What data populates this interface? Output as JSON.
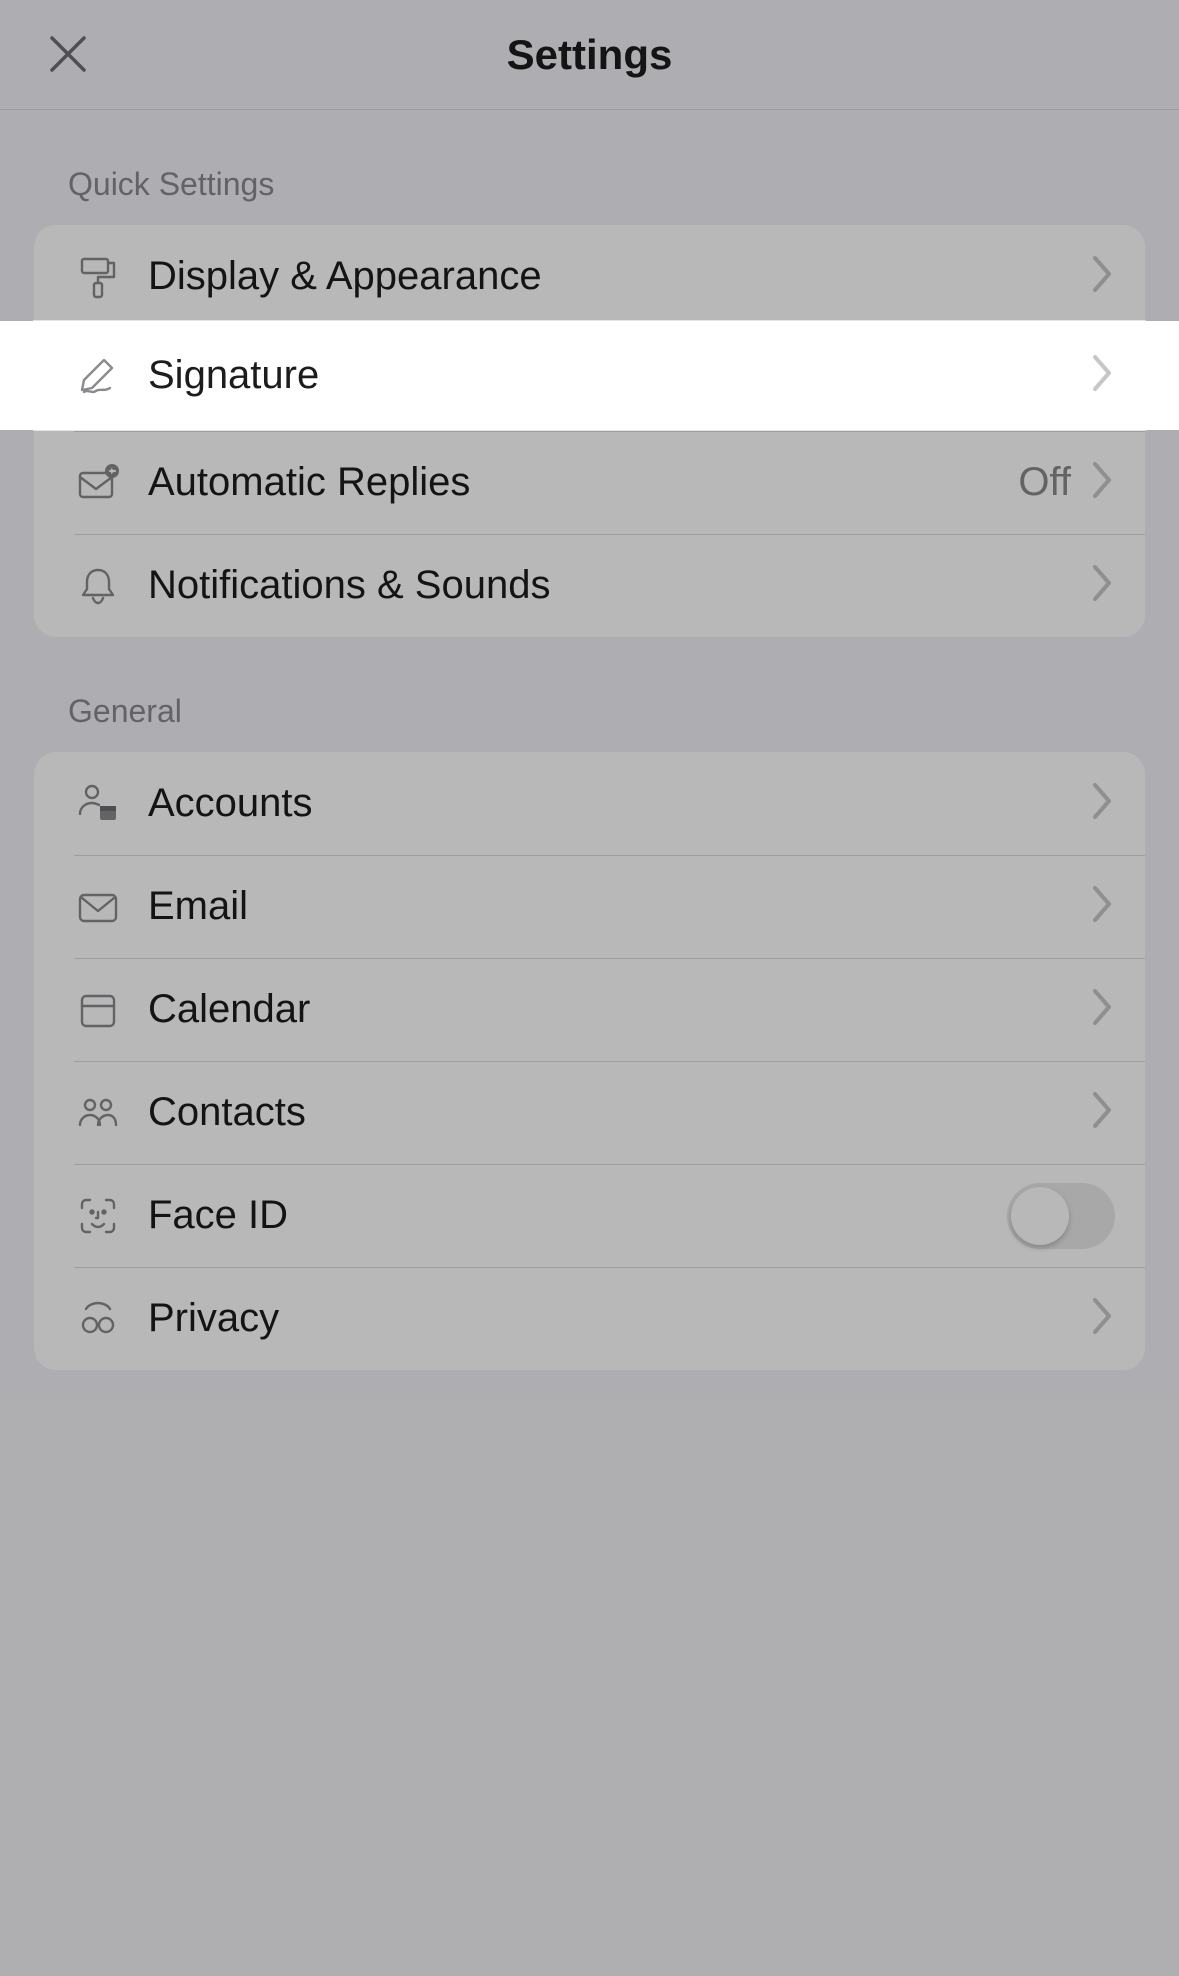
{
  "header": {
    "title": "Settings"
  },
  "sections": {
    "quick": {
      "title": "Quick Settings",
      "display_appearance": "Display & Appearance",
      "signature": "Signature",
      "automatic_replies": {
        "label": "Automatic Replies",
        "value": "Off"
      },
      "notifications": "Notifications & Sounds"
    },
    "general": {
      "title": "General",
      "accounts": "Accounts",
      "email": "Email",
      "calendar": "Calendar",
      "contacts": "Contacts",
      "face_id": {
        "label": "Face ID",
        "on": false
      },
      "privacy": "Privacy"
    }
  }
}
